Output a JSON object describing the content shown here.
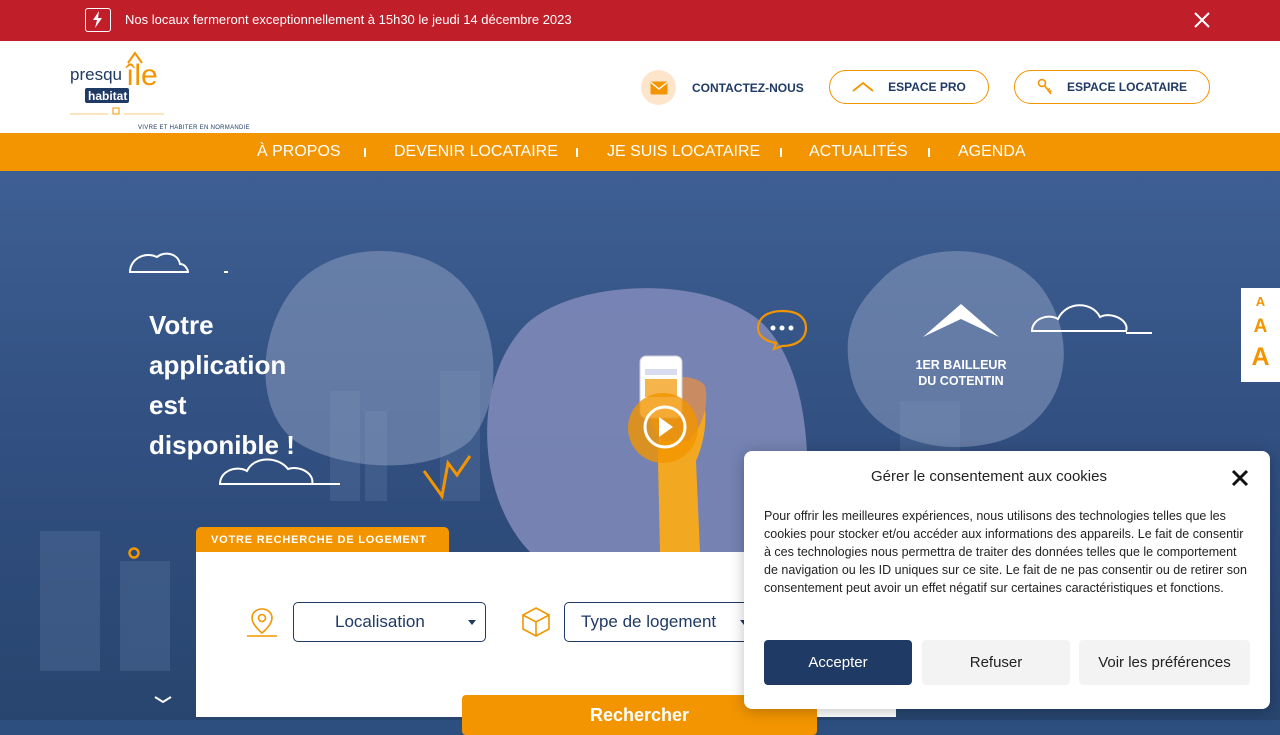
{
  "alert": {
    "text": "Nos locaux fermeront exceptionnellement à 15h30 le jeudi 14 décembre 2023"
  },
  "header": {
    "logo_tagline": "VIVRE ET HABITER EN NORMANDIE",
    "contact_label": "CONTACTEZ-NOUS",
    "pro_label": "ESPACE PRO",
    "tenant_label": "ESPACE LOCATAIRE"
  },
  "nav": {
    "items": [
      "À PROPOS",
      "DEVENIR LOCATAIRE",
      "JE SUIS LOCATAIRE",
      "ACTUALITÉS",
      "AGENDA"
    ]
  },
  "hero": {
    "title_lines": [
      "Votre",
      "application",
      "est",
      "disponible !"
    ],
    "badge_line1": "1ER BAILLEUR",
    "badge_line2": "DU COTENTIN"
  },
  "search": {
    "tab_label": "VOTRE RECHERCHE DE LOGEMENT",
    "location_value": "Localisation",
    "type_value": "Type de logement",
    "submit_label": "Rechercher"
  },
  "text_size": {
    "small": "A",
    "medium": "A",
    "large": "A"
  },
  "cookie": {
    "title": "Gérer le consentement aux cookies",
    "body": "Pour offrir les meilleures expériences, nous utilisons des technologies telles que les cookies pour stocker et/ou accéder aux informations des appareils. Le fait de consentir à ces technologies nous permettra de traiter des données telles que le comportement de navigation ou les ID uniques sur ce site. Le fait de ne pas consentir ou de retirer son consentement peut avoir un effet négatif sur certaines caractéristiques et fonctions.",
    "accept_label": "Accepter",
    "refuse_label": "Refuser",
    "prefs_label": "Voir les préférences"
  },
  "colors": {
    "brand_orange": "#f29500",
    "brand_navy": "#1f3a64",
    "alert_red": "#c01f2a"
  }
}
